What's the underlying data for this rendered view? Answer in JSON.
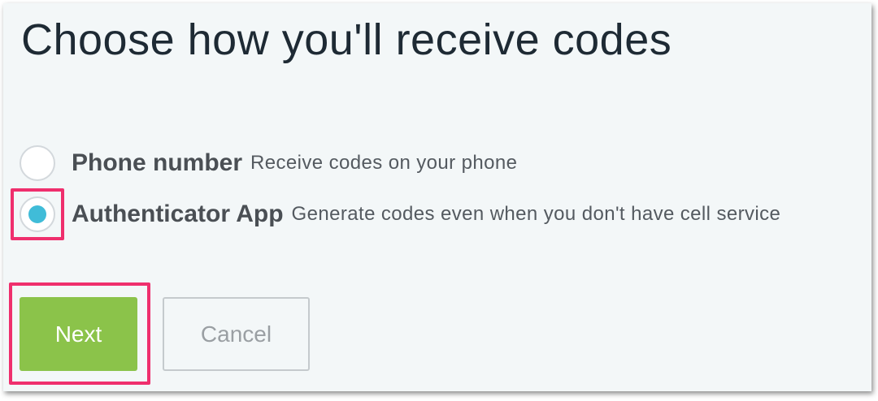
{
  "page": {
    "title": "Choose how you'll receive codes"
  },
  "options": [
    {
      "label": "Phone number",
      "description": "Receive codes on your phone",
      "selected": false
    },
    {
      "label": "Authenticator App",
      "description": "Generate codes even when you don't have cell service",
      "selected": true
    }
  ],
  "buttons": {
    "next_label": "Next",
    "cancel_label": "Cancel"
  },
  "colors": {
    "background": "#f3f7f8",
    "title_text": "#1e2a34",
    "radio_selected": "#40bcd8",
    "next_button": "#8bc34a",
    "highlight": "#ef2f6d"
  }
}
